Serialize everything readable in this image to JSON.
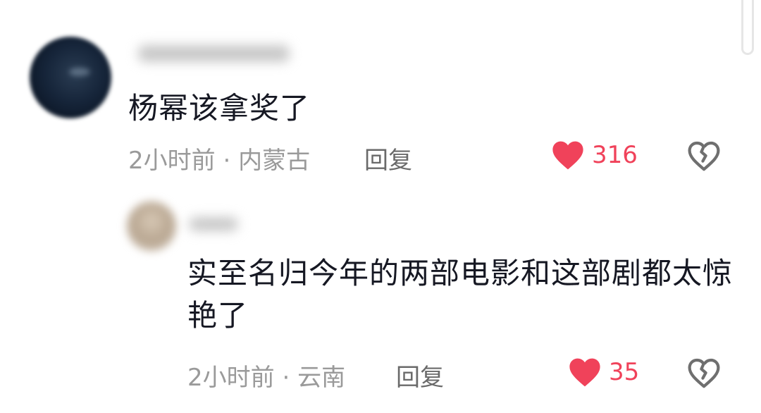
{
  "colors": {
    "like": "#f0425a",
    "text": "#161823",
    "meta": "#9a9a9a"
  },
  "comments": [
    {
      "text": "杨幂该拿奖了",
      "time": "2小时前",
      "separator": " · ",
      "location": "内蒙古",
      "reply_label": "回复",
      "like_count": "316",
      "like_icon": "heart-icon",
      "dislike_icon": "broken-heart-icon"
    },
    {
      "text": "实至名归今年的两部电影和这部剧都太惊艳了",
      "time": "2小时前",
      "separator": " · ",
      "location": "云南",
      "reply_label": "回复",
      "like_count": "35",
      "like_icon": "heart-icon",
      "dislike_icon": "broken-heart-icon"
    }
  ]
}
